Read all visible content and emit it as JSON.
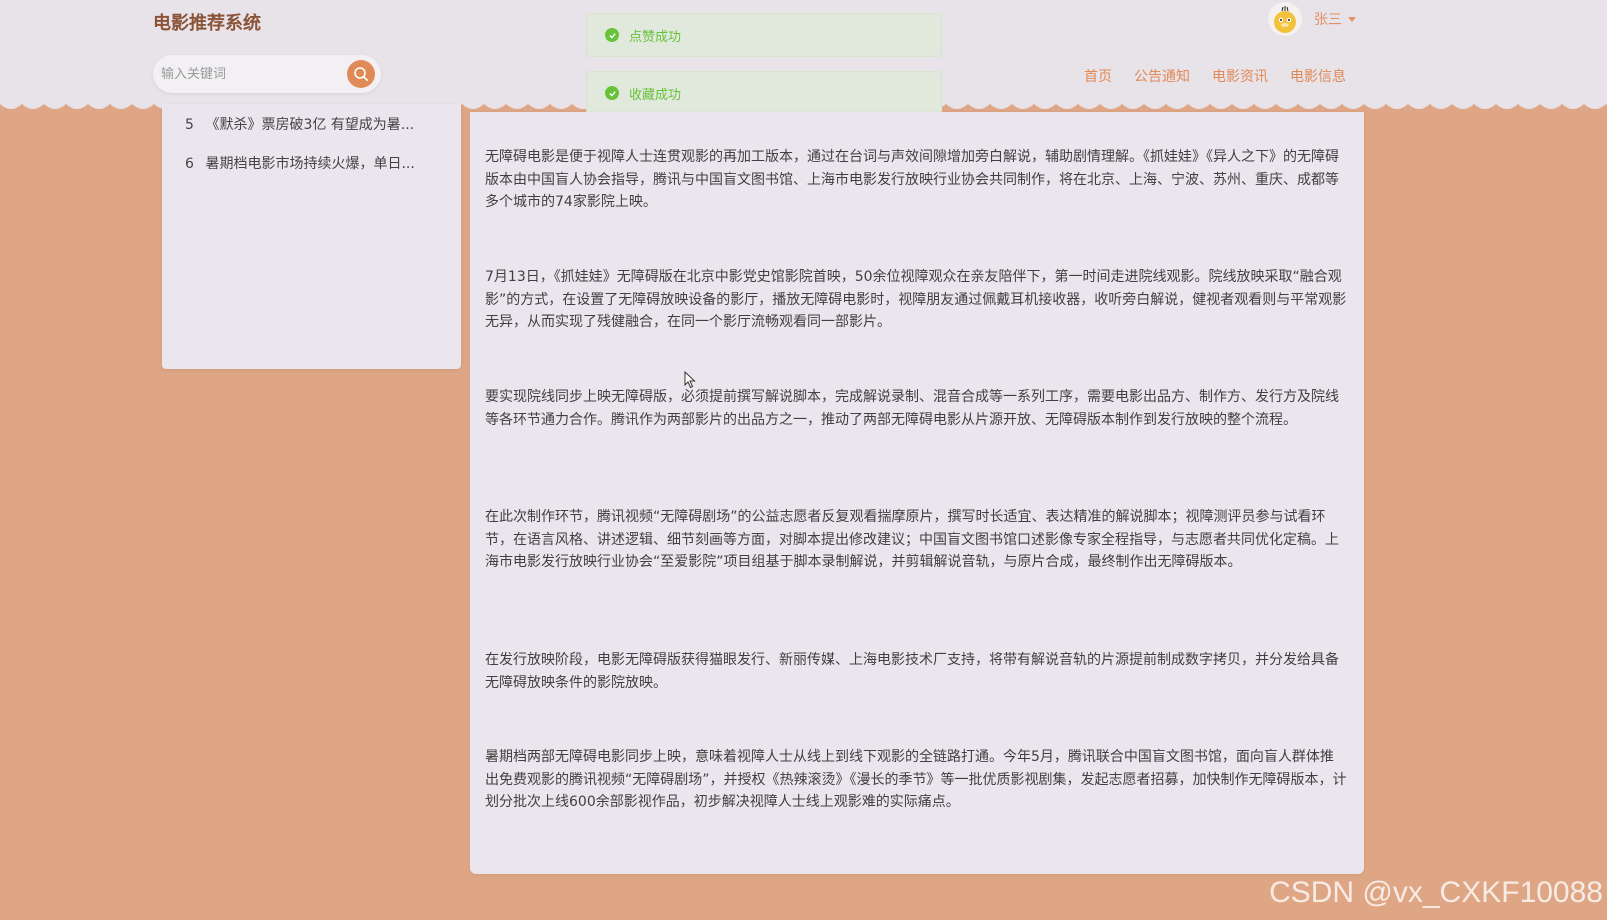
{
  "app": {
    "title": "电影推荐系统"
  },
  "search": {
    "placeholder": "输入关键词"
  },
  "toasts": [
    {
      "text": "点赞成功"
    },
    {
      "text": "收藏成功"
    }
  ],
  "user": {
    "name": "张三"
  },
  "nav": [
    {
      "label": "首页"
    },
    {
      "label": "公告通知"
    },
    {
      "label": "电影资讯"
    },
    {
      "label": "电影信息"
    }
  ],
  "sidebar": {
    "items": [
      {
        "num": "5",
        "title": "《默杀》票房破3亿 有望成为暑..."
      },
      {
        "num": "6",
        "title": "暑期档电影市场持续火爆，单日..."
      }
    ]
  },
  "article": {
    "paragraphs": [
      "无障碍电影是便于视障人士连贯观影的再加工版本，通过在台词与声效间隙增加旁白解说，辅助剧情理解。《抓娃娃》《异人之下》的无障碍版本由中国盲人协会指导，腾讯与中国盲文图书馆、上海市电影发行放映行业协会共同制作，将在北京、上海、宁波、苏州、重庆、成都等多个城市的74家影院上映。",
      "7月13日，《抓娃娃》无障碍版在北京中影党史馆影院首映，50余位视障观众在亲友陪伴下，第一时间走进院线观影。院线放映采取“融合观影”的方式，在设置了无障碍放映设备的影厅，播放无障碍电影时，视障朋友通过佩戴耳机接收器，收听旁白解说，健视者观看则与平常观影无异，从而实现了残健融合，在同一个影厅流畅观看同一部影片。",
      "要实现院线同步上映无障碍版，必须提前撰写解说脚本，完成解说录制、混音合成等一系列工序，需要电影出品方、制作方、发行方及院线等各环节通力合作。腾讯作为两部影片的出品方之一，推动了两部无障碍电影从片源开放、无障碍版本制作到发行放映的整个流程。",
      "在此次制作环节，腾讯视频“无障碍剧场”的公益志愿者反复观看揣摩原片，撰写时长适宜、表达精准的解说脚本；视障测评员参与试看环节，在语言风格、讲述逻辑、细节刻画等方面，对脚本提出修改建议；中国盲文图书馆口述影像专家全程指导，与志愿者共同优化定稿。上海市电影发行放映行业协会“至爱影院”项目组基于脚本录制解说，并剪辑解说音轨，与原片合成，最终制作出无障碍版本。",
      "在发行放映阶段，电影无障碍版获得猫眼发行、新丽传媒、上海电影技术厂支持，将带有解说音轨的片源提前制成数字拷贝，并分发给具备无障碍放映条件的影院放映。",
      "暑期档两部无障碍电影同步上映，意味着视障人士从线上到线下观影的全链路打通。今年5月，腾讯联合中国盲文图书馆，面向盲人群体推出免费观影的腾讯视频“无障碍剧场”，并授权《热辣滚烫》《漫长的季节》等一批优质影视剧集，发起志愿者招募，加快制作无障碍版本，计划分批次上线600余部影视作品，初步解决视障人士线上观影难的实际痛点。"
    ]
  },
  "watermark": "CSDN @vx_CXKF10088",
  "colors": {
    "accent": "#e08b57",
    "background": "#dea685",
    "panel": "#ebe6ed",
    "success": "#67c23a"
  }
}
